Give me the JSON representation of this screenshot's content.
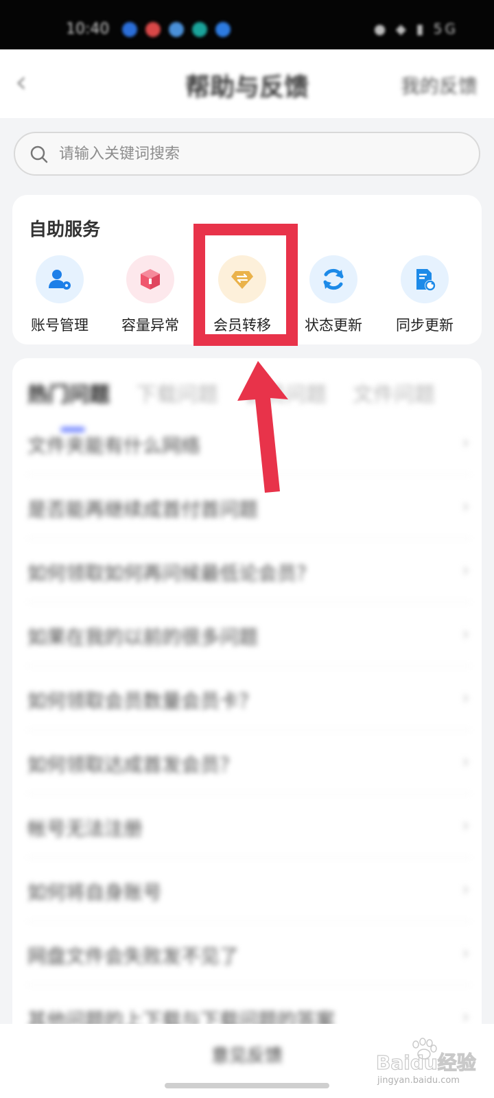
{
  "status_bar": {
    "time": "10:40",
    "indicators": "● ◆ ▮ 5G"
  },
  "header": {
    "back_icon": "chevron-left-icon",
    "title": "帮助与反馈",
    "action": "我的反馈"
  },
  "search": {
    "placeholder": "请输入关键词搜索",
    "icon": "search-icon"
  },
  "self_service": {
    "title": "自助服务",
    "items": [
      {
        "label": "账号管理",
        "icon": "account-settings-icon",
        "bg": "#e6f2fe",
        "fg": "#1d7fe8"
      },
      {
        "label": "容量异常",
        "icon": "cube-icon",
        "bg": "#fde8ec",
        "fg": "#f0576e"
      },
      {
        "label": "会员转移",
        "icon": "diamond-transfer-icon",
        "bg": "#fdf0da",
        "fg": "#e9b44c"
      },
      {
        "label": "状态更新",
        "icon": "refresh-icon",
        "bg": "#e6f2fe",
        "fg": "#1d8ae8"
      },
      {
        "label": "同步更新",
        "icon": "file-sync-icon",
        "bg": "#e6f2fe",
        "fg": "#1d8ae8"
      }
    ]
  },
  "faq": {
    "tabs": [
      "热门问题",
      "下载问题",
      "会员问题",
      "文件问题"
    ],
    "items": [
      "文件夹能有什么网络",
      "是否能再继续成首付首问题",
      "如何领取如何再问候最低论会员？",
      "如果在我的以前的很多问题",
      "如何领取会员数量会员卡？",
      "如何领取达成首发会员？",
      "帐号无法注册",
      "如何将自身账号",
      "网盘文件会失败发不见了",
      "其他问题的上下载与下载问题的答案"
    ]
  },
  "bottom": {
    "button": "意见反馈"
  },
  "annotation": {
    "color": "#e8334a"
  },
  "watermark": {
    "brand": "Baidu经验",
    "url": "jingyan.baidu.com"
  }
}
